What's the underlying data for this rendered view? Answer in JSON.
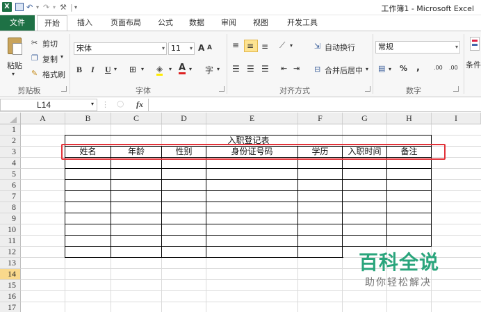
{
  "titlebar": {
    "app_icon": "X",
    "title": "工作簿1 - Microsoft Excel",
    "qa_undo": "↶",
    "qa_redo": "↷",
    "qa_sep": "|"
  },
  "tabs": [
    "文件",
    "开始",
    "插入",
    "页面布局",
    "公式",
    "数据",
    "审阅",
    "视图",
    "开发工具"
  ],
  "ribbon": {
    "clipboard": {
      "paste": "粘贴",
      "cut": "剪切",
      "copy": "复制",
      "format_painter": "格式刷",
      "label": "剪贴板"
    },
    "font": {
      "name": "宋体",
      "size": "11",
      "bold": "B",
      "italic": "I",
      "underline": "U",
      "grow": "A",
      "shrink": "A",
      "label": "字体"
    },
    "alignment": {
      "wrap": "自动换行",
      "merge": "合并后居中",
      "label": "对齐方式"
    },
    "number": {
      "format": "常规",
      "percent": "%",
      "comma": ",",
      "inc_decimal": ".00",
      "dec_decimal": ".00",
      "label": "数字"
    },
    "styles": {
      "conditional": "条件"
    }
  },
  "formula_bar": {
    "cell_ref": "L14",
    "fx": "fx",
    "value": ""
  },
  "grid": {
    "columns": [
      "A",
      "B",
      "C",
      "D",
      "E",
      "F",
      "G",
      "H",
      "I"
    ],
    "rows": [
      "1",
      "2",
      "3",
      "4",
      "5",
      "6",
      "7",
      "8",
      "9",
      "10",
      "11",
      "12",
      "13",
      "14",
      "15",
      "16",
      "17"
    ],
    "selected_row": "14",
    "table_title": "入职登记表",
    "headers": [
      "姓名",
      "年龄",
      "性别",
      "身份证号码",
      "学历",
      "入职时间",
      "备注"
    ]
  },
  "watermark": {
    "title": "百科全说",
    "subtitle": "助你轻松解决"
  },
  "colors": {
    "excel_green": "#1e7145",
    "highlight": "#e2333a",
    "watermark": "#2aa57c",
    "selected_header": "#f9d98c"
  }
}
